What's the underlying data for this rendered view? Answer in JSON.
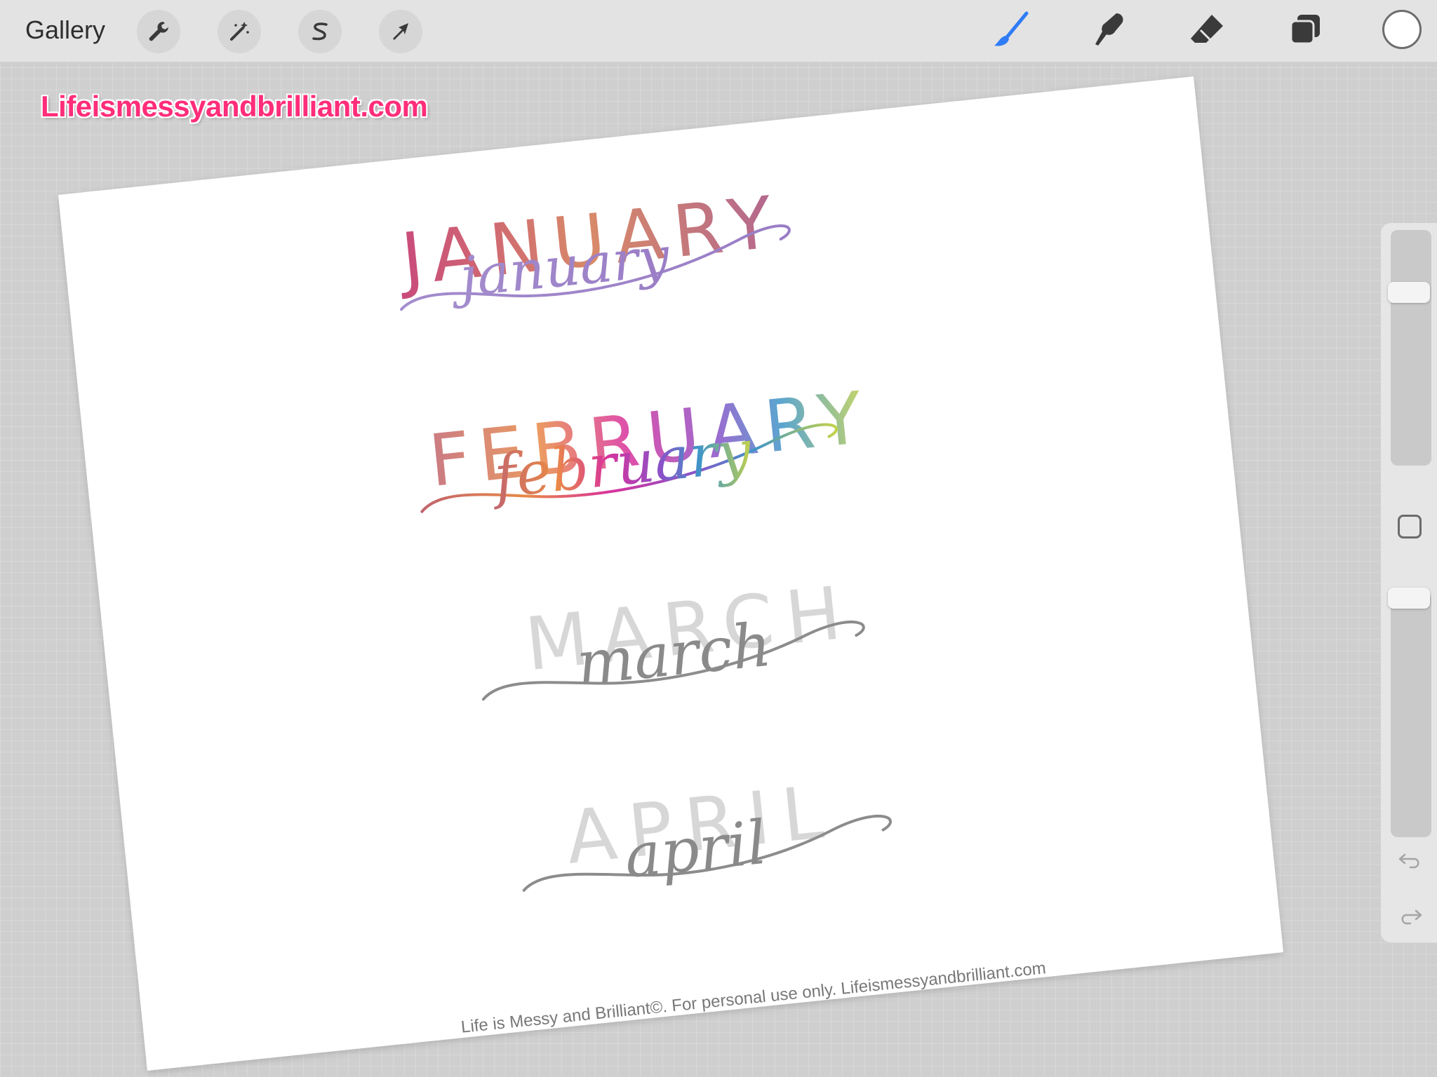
{
  "toolbar": {
    "gallery_label": "Gallery",
    "left_tools": [
      {
        "name": "actions",
        "icon": "wrench-icon"
      },
      {
        "name": "adjustments",
        "icon": "magic-wand-icon"
      },
      {
        "name": "selection",
        "icon": "selection-s-icon"
      },
      {
        "name": "transform",
        "icon": "arrow-cursor-icon"
      }
    ],
    "right_tools": [
      {
        "name": "brush",
        "icon": "brush-icon",
        "active": true
      },
      {
        "name": "smudge",
        "icon": "smudge-icon"
      },
      {
        "name": "eraser",
        "icon": "eraser-icon"
      },
      {
        "name": "layers",
        "icon": "layers-icon"
      }
    ],
    "current_color": "#ffffff",
    "active_color": "#2f7cf6"
  },
  "watermark": "Lifeismessyandbrilliant.com",
  "artwork": {
    "months": [
      {
        "caps": "JANUARY",
        "script": "january"
      },
      {
        "caps": "FEBRUARY",
        "script": "february"
      },
      {
        "caps": "MARCH",
        "script": "march"
      },
      {
        "caps": "APRIL",
        "script": "april"
      }
    ],
    "footer": "Life is Messy and Brilliant©. For personal use only. Lifeismessyandbrilliant.com"
  },
  "sidebar": {
    "brush_size_level": 0.75,
    "opacity_level": 1.0,
    "modify_icon": "square-icon",
    "undo_icon": "undo-icon",
    "redo_icon": "redo-icon"
  }
}
